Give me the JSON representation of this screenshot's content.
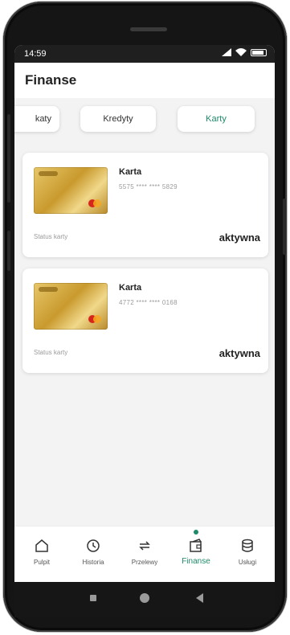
{
  "status_bar": {
    "time": "14:59"
  },
  "header": {
    "title": "Finanse"
  },
  "tabs": [
    {
      "label": "katy"
    },
    {
      "label": "Kredyty"
    },
    {
      "label": "Karty",
      "active": true
    }
  ],
  "cards": [
    {
      "name": "Karta",
      "number": "5575 **** **** 5829",
      "status_label": "Status karty",
      "status": "aktywna"
    },
    {
      "name": "Karta",
      "number": "4772 **** **** 0168",
      "status_label": "Status karty",
      "status": "aktywna"
    }
  ],
  "bottom_nav": [
    {
      "label": "Pulpit",
      "icon": "home-icon"
    },
    {
      "label": "Historia",
      "icon": "history-icon"
    },
    {
      "label": "Przelewy",
      "icon": "transfer-icon"
    },
    {
      "label": "Finanse",
      "icon": "wallet-icon",
      "active": true
    },
    {
      "label": "Usługi",
      "icon": "database-icon"
    }
  ],
  "colors": {
    "accent": "#1f8a6a",
    "background": "#f3f3f4",
    "status_bar": "#1f1f1f"
  }
}
